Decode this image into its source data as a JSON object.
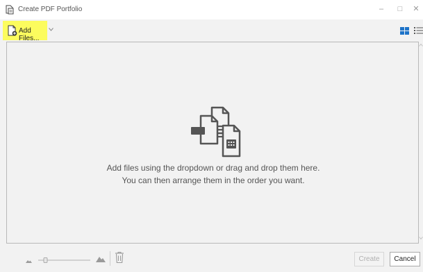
{
  "window": {
    "title": "Create PDF Portfolio",
    "minimize_glyph": "–",
    "maximize_glyph": "□",
    "close_glyph": "✕"
  },
  "toolbar": {
    "add_files_label": "Add Files...",
    "highlight_color": "#fcfc5e",
    "view_icons": [
      "grid-view-icon",
      "list-view-icon"
    ],
    "accent_color": "#1e73c8"
  },
  "dropzone": {
    "line1": "Add files using the dropdown or drag and drop them here.",
    "line2": "You can then arrange them in the order you want."
  },
  "footer": {
    "create_label": "Create",
    "cancel_label": "Cancel"
  }
}
